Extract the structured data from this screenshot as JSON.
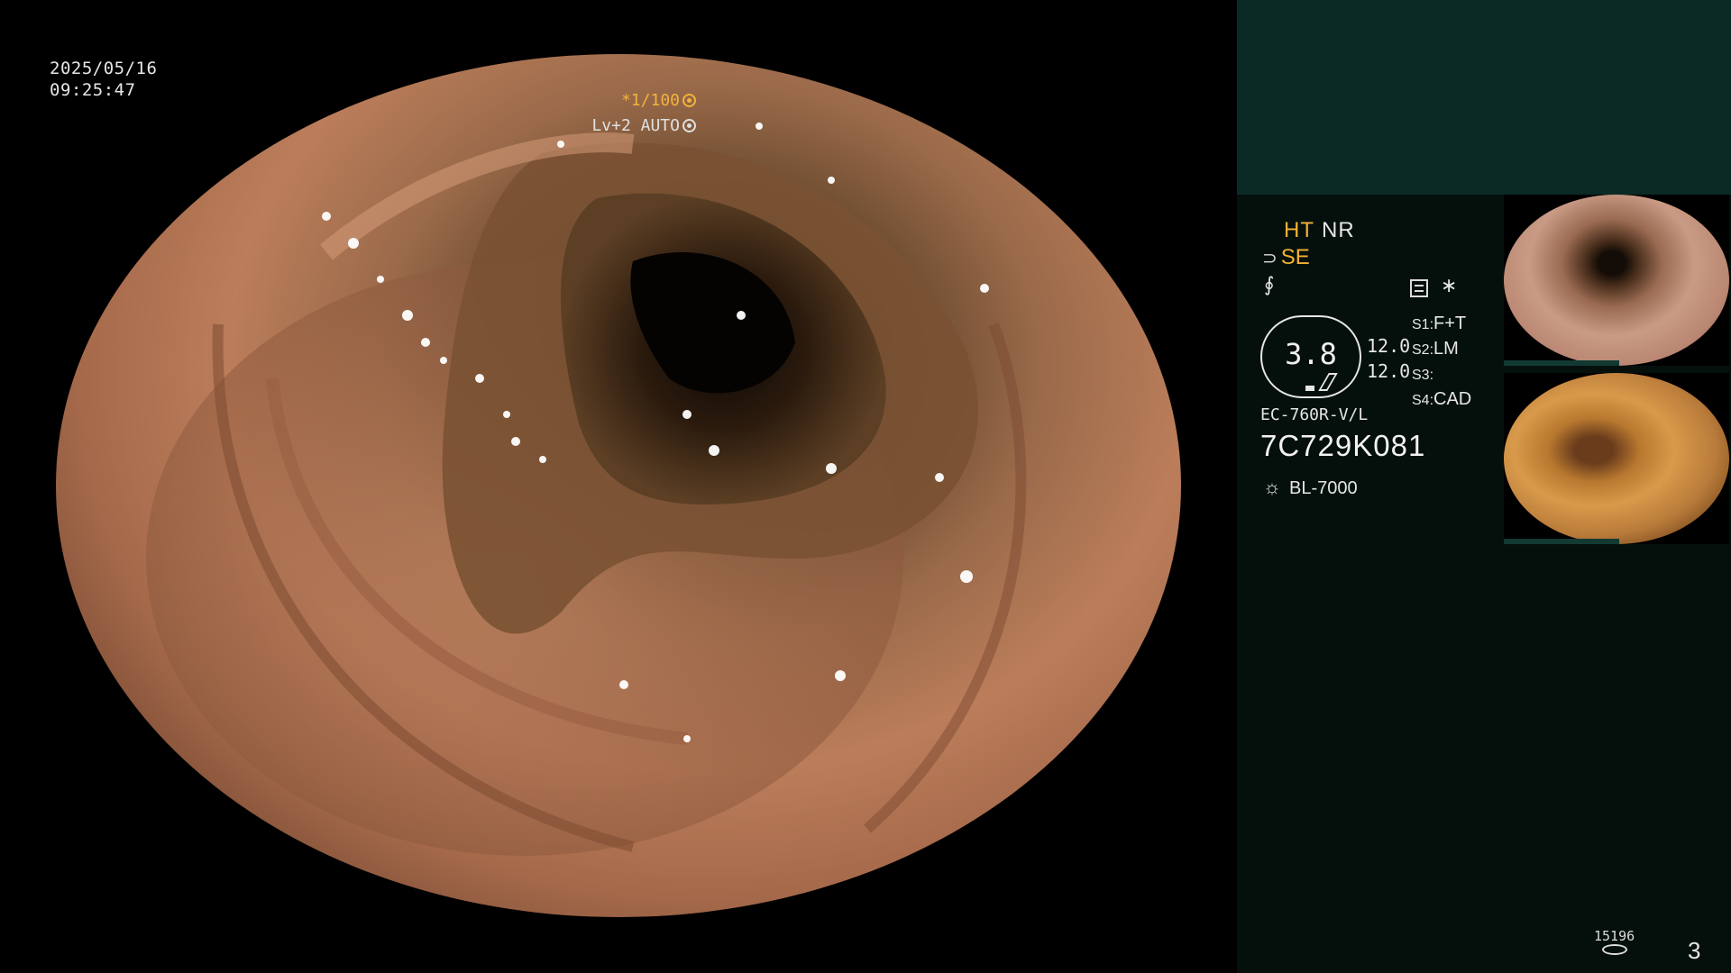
{
  "overlay": {
    "date": "2025/05/16",
    "time": "09:25:47",
    "shutter": "*1/100",
    "level": "Lv+2 AUTO"
  },
  "panel": {
    "mode_ht": "HT",
    "mode_nr": "NR",
    "se_label": "SE",
    "gauge_value": "3.8",
    "readout_1": "12.0",
    "readout_2": "12.0",
    "s_list": [
      {
        "label": "S1:",
        "value": "F+T"
      },
      {
        "label": "S2:",
        "value": "LM"
      },
      {
        "label": "S3:",
        "value": ""
      },
      {
        "label": "S4:",
        "value": "CAD"
      }
    ],
    "scope_model": "EC-760R-V/L",
    "scope_serial": "7C729K081",
    "light_source": "BL-7000",
    "record_count": "15196",
    "page_number": "3"
  },
  "icons": {
    "shutter_icon": "aperture-icon",
    "level_icon": "target-icon",
    "se_icon": "tilde-wave-icon",
    "structure_icon": "structure-enhance-icon",
    "record_icon": "document-icon",
    "star_icon": "asterisk-icon",
    "light_icon": "sun-icon",
    "disk_icon": "disk-icon"
  },
  "colors": {
    "accent": "#f2b234",
    "panel_bg": "#05100d",
    "panel_top": "#0c2a25"
  }
}
